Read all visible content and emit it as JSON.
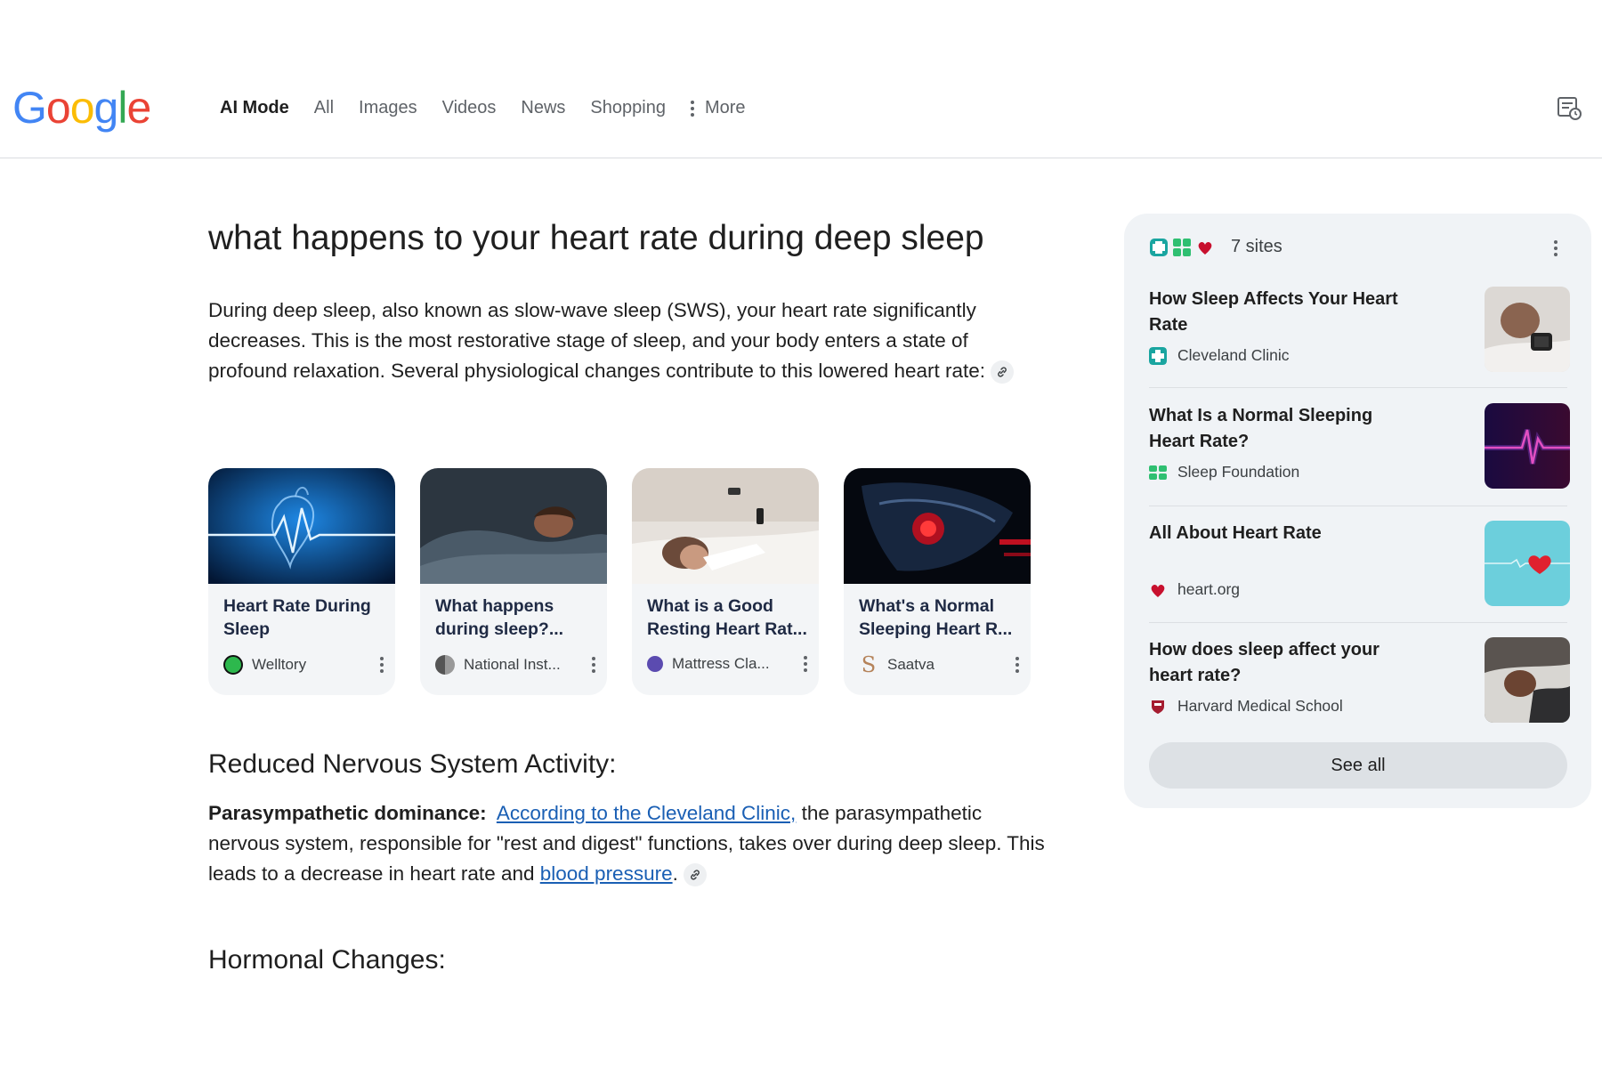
{
  "header": {
    "logo": "Google",
    "logo_colors": [
      "#4285F4",
      "#EA4335",
      "#FBBC05",
      "#4285F4",
      "#34A853",
      "#EA4335"
    ],
    "tabs": [
      {
        "label": "AI Mode",
        "active": true
      },
      {
        "label": "All",
        "active": false
      },
      {
        "label": "Images",
        "active": false
      },
      {
        "label": "Videos",
        "active": false
      },
      {
        "label": "News",
        "active": false
      },
      {
        "label": "Shopping",
        "active": false
      }
    ],
    "more_label": "More",
    "history_icon": "history-icon"
  },
  "main": {
    "query": "what happens to your heart rate during deep sleep",
    "intro": "During deep sleep, also known as slow-wave sleep (SWS), your heart rate significantly decreases. This is the most restorative stage of sleep, and your body enters a state of profound relaxation. Several physiological changes contribute to this lowered heart rate:",
    "cards": [
      {
        "title": "Heart Rate During Sleep",
        "source": "Welltory",
        "image": "blue-heart-ecg-illustration"
      },
      {
        "title": "What happens during sleep?...",
        "source": "National Inst...",
        "image": "person-sleeping-dark"
      },
      {
        "title": "What is a Good Resting Heart Rat...",
        "source": "Mattress Cla...",
        "image": "woman-in-bed-with-phone"
      },
      {
        "title": "What's a Normal Sleeping Heart R...",
        "source": "Saatva",
        "image": "red-heart-xray"
      }
    ],
    "section1": {
      "heading": "Reduced Nervous System Activity:",
      "bold_lead": "Parasympathetic dominance:",
      "link1": "According to the Cleveland Clinic,",
      "text1": " the parasympathetic nervous system, responsible for \"rest and digest\" functions, takes over during deep sleep. This leads to a decrease in heart rate and ",
      "link2": "blood pressure",
      "text2": "."
    },
    "section2": {
      "heading": "Hormonal Changes:"
    }
  },
  "sources_panel": {
    "count_label": "7 sites",
    "items": [
      {
        "title": "How Sleep Affects Your Heart Rate",
        "source": "Cleveland Clinic",
        "source_color": "#1aa5a0",
        "thumb": "man-sleeping-smartwatch"
      },
      {
        "title": "What Is a Normal Sleeping Heart Rate?",
        "source": "Sleep Foundation",
        "source_color": "#2fbf71",
        "thumb": "purple-ecg-line"
      },
      {
        "title": "All About Heart Rate",
        "source": "heart.org",
        "source_color": "#c8102e",
        "thumb": "heart-on-teal"
      },
      {
        "title": "How does sleep affect your heart rate?",
        "source": "Harvard Medical School",
        "source_color": "#a51c30",
        "thumb": "man-sleeping-pillow"
      }
    ],
    "see_all_label": "See all"
  }
}
